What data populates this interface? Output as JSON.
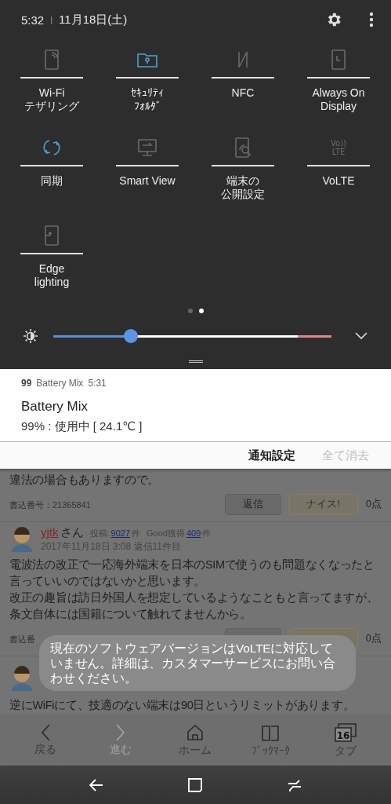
{
  "status": {
    "time": "5:32",
    "separator": "|",
    "date": "11月18日(土)"
  },
  "tiles": [
    {
      "kind": "hotspot",
      "label_lines": [
        "Wi-Fi",
        "テザリング"
      ],
      "on": false
    },
    {
      "kind": "folder",
      "label_lines": [
        "ｾｷｭﾘﾃｨ",
        "ﾌｫﾙﾀﾞ"
      ],
      "on": true
    },
    {
      "kind": "nfc",
      "label_lines": [
        "NFC"
      ],
      "on": false
    },
    {
      "kind": "clock",
      "label_lines": [
        "Always On",
        "Display"
      ],
      "on": false
    },
    {
      "kind": "sync",
      "label_lines": [
        "同期"
      ],
      "on": true
    },
    {
      "kind": "cast",
      "label_lines": [
        "Smart View"
      ],
      "on": false
    },
    {
      "kind": "search",
      "label_lines": [
        "端末の",
        "公開設定"
      ],
      "on": false
    },
    {
      "kind": "volte",
      "label_lines": [
        "VoLTE"
      ],
      "on": false,
      "icon_text": [
        "Vo))",
        "LTE"
      ]
    },
    {
      "kind": "edge",
      "label_lines": [
        "Edge",
        "lighting"
      ],
      "on": false
    }
  ],
  "pages": [
    {
      "selected": false
    },
    {
      "selected": true
    }
  ],
  "brightness": {
    "level": 0.28
  },
  "notification": {
    "icon_text": "99",
    "app": "Battery Mix",
    "time": "5:31",
    "title": "Battery Mix",
    "text": "99% : 使用中 [ 24.1℃ ]"
  },
  "notification_actions": [
    {
      "label": "通知設定",
      "disabled": false
    },
    {
      "label": "全て消去",
      "disabled": true
    }
  ],
  "posts": [
    {
      "body": [
        "違法の場合もありますので。"
      ],
      "number": "書込番号：21365841",
      "reply": "返信",
      "nice": "ナイス!",
      "score": "0点"
    },
    {
      "author": "yjtk",
      "honorific": "さん",
      "stats": [
        {
          "label": "投稿:",
          "count": "9027",
          "unit": "件"
        },
        {
          "label": "Good獲得",
          "count": "409",
          "unit": "件"
        }
      ],
      "date": "2017年11月18日 3:08 返信11件目",
      "body": [
        "電波法の改正で一応海外端末を日本のSIMで使うのも問題なくなったと言っていいのではないかと思います。",
        "改正の趣旨は訪日外国人を想定しているようなこともと言ってますが、条文自体には国籍について触れてませんから。"
      ],
      "number": "書込番",
      "score": "0点"
    },
    {
      "body": [
        "逆にWiFiにて、技適のない端末は90日というリミットがあります。"
      ]
    }
  ],
  "toast": "現在のソフトウェアバージョンはVoLTEに対応していません。詳細は、カスタマーサービスにお問い合わせください。",
  "browser_bar": [
    {
      "kind": "back",
      "label": "戻る",
      "disabled": false
    },
    {
      "kind": "forward",
      "label": "進む",
      "disabled": true
    },
    {
      "kind": "home",
      "label": "ホーム",
      "disabled": false
    },
    {
      "kind": "bookmark",
      "label": "ﾌﾞｯｸﾏｰｸ",
      "disabled": false
    },
    {
      "kind": "tabs",
      "label": "タブ",
      "disabled": false,
      "count": "16"
    }
  ],
  "nav": [
    {
      "kind": "back"
    },
    {
      "kind": "home"
    },
    {
      "kind": "recent"
    }
  ]
}
